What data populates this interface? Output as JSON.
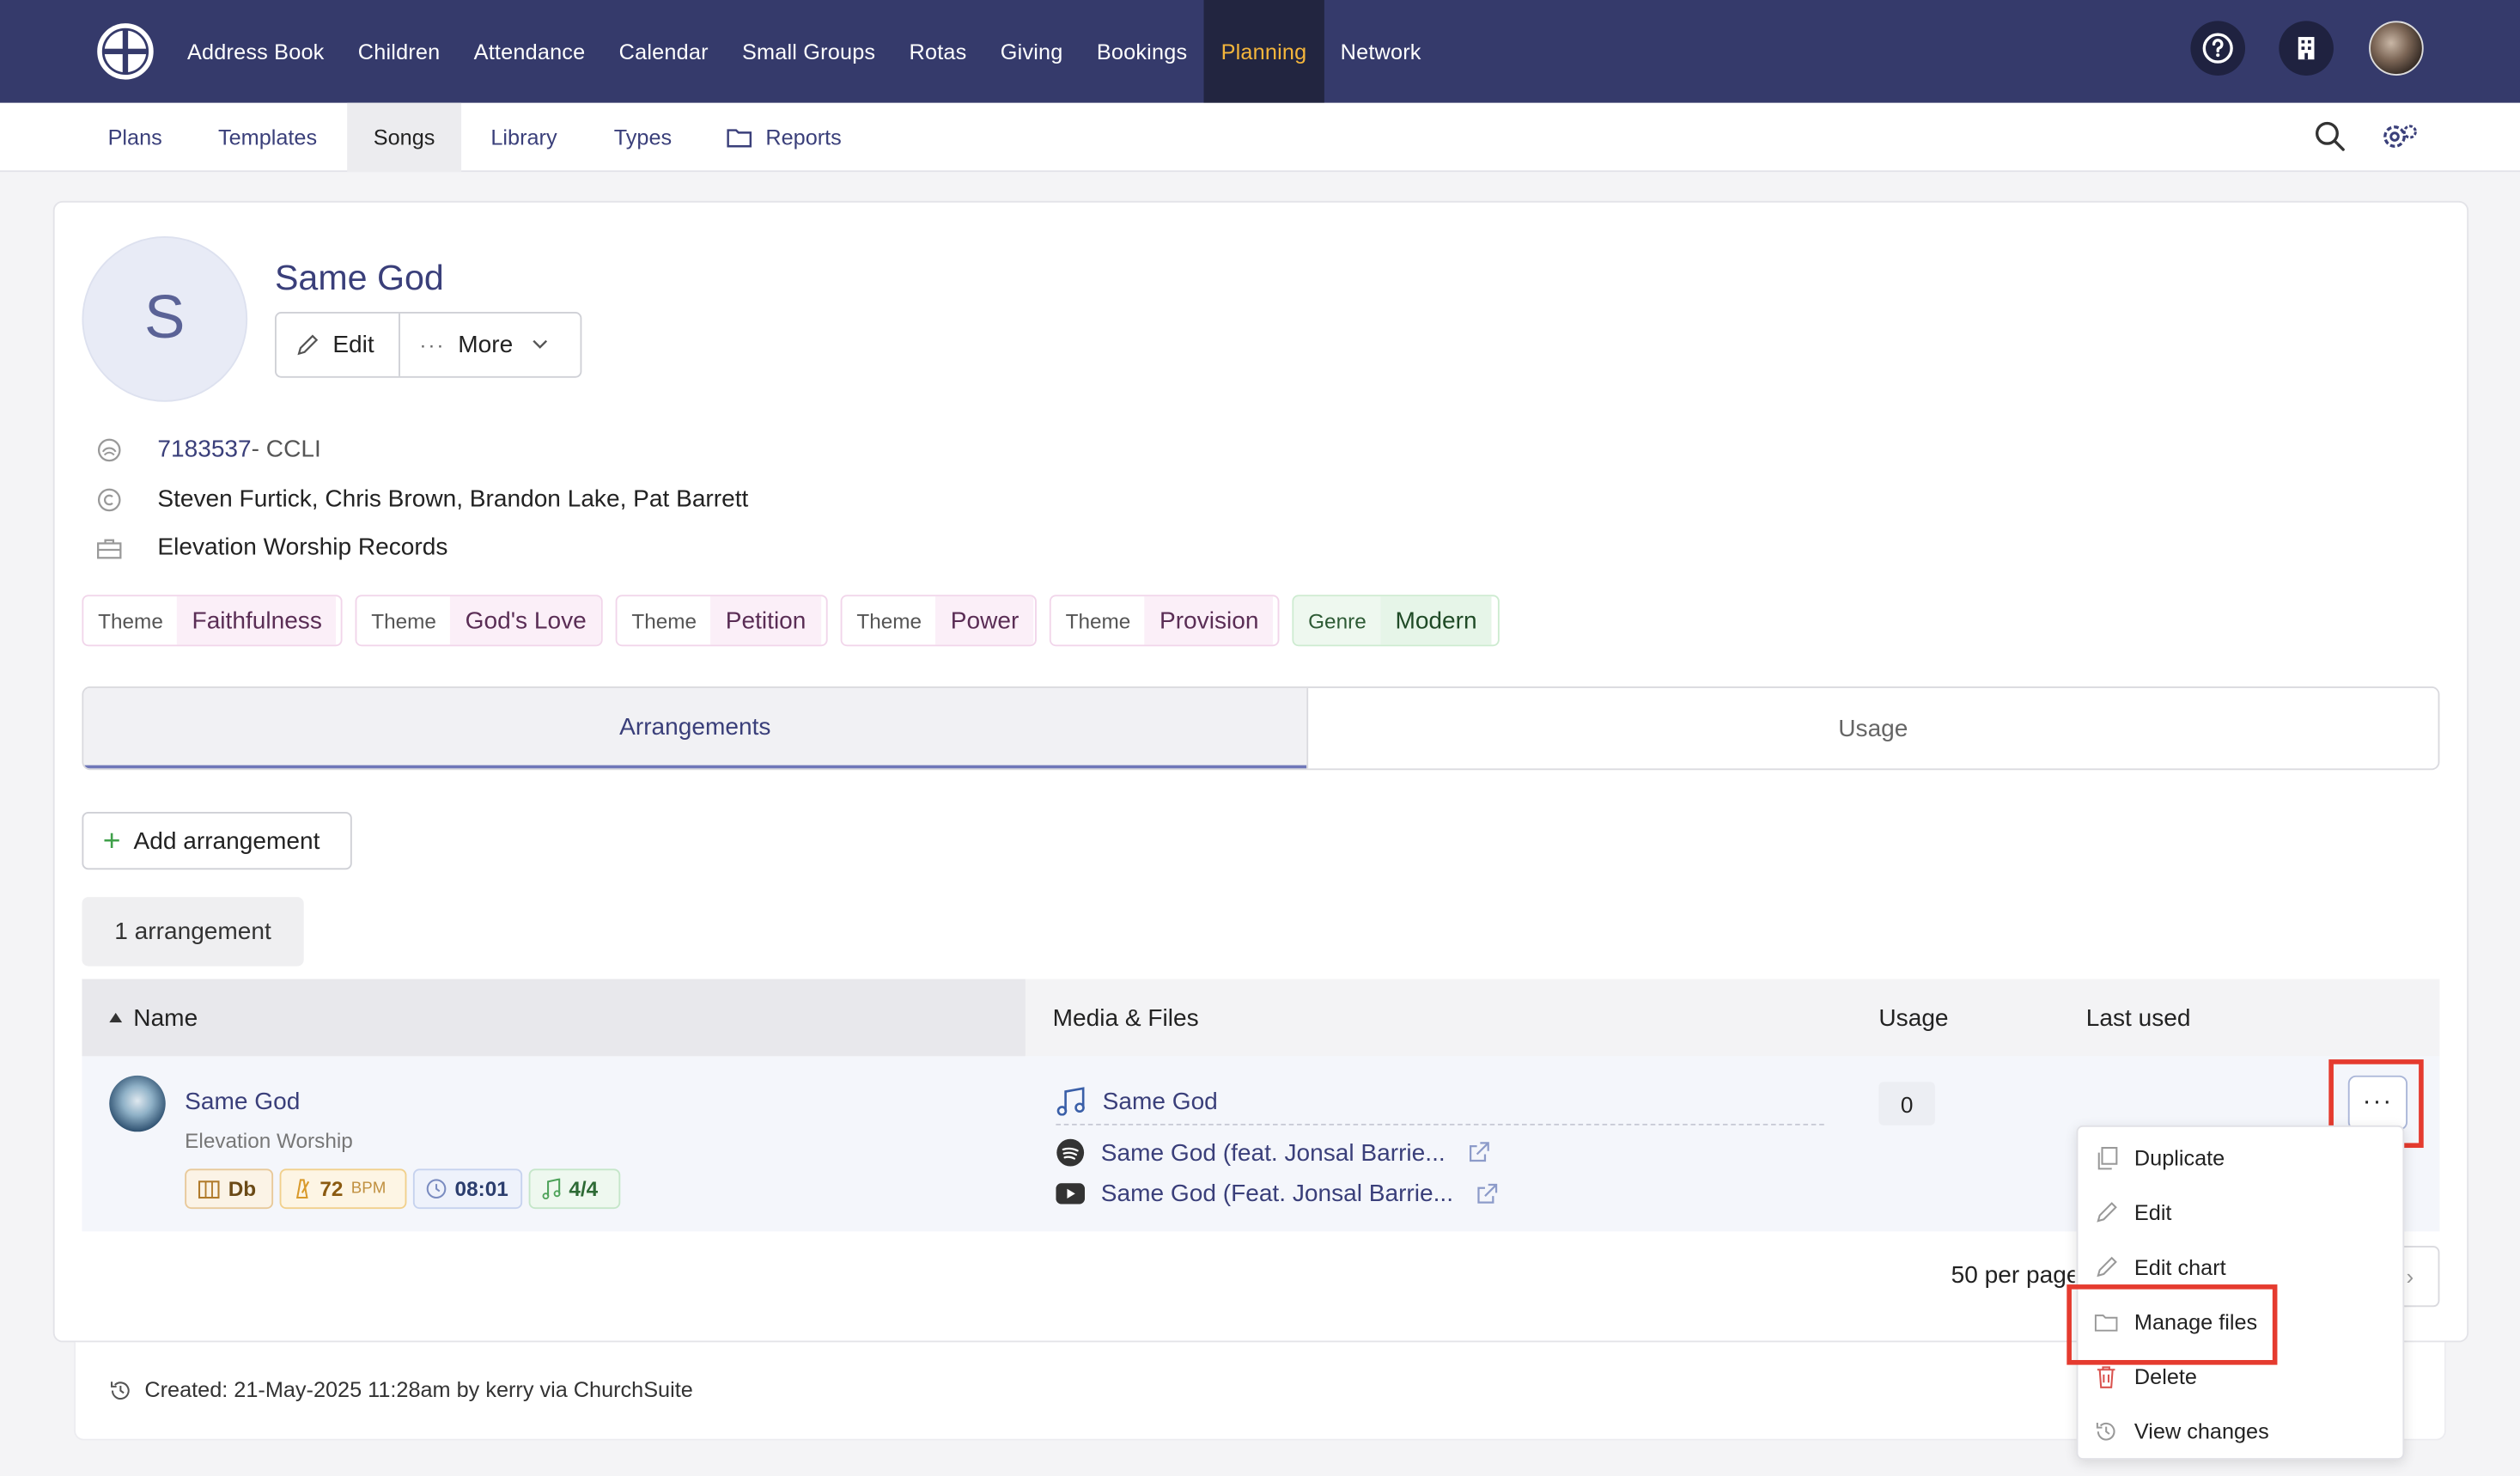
{
  "top_nav": {
    "items": [
      {
        "label": "Address Book"
      },
      {
        "label": "Children"
      },
      {
        "label": "Attendance"
      },
      {
        "label": "Calendar"
      },
      {
        "label": "Small Groups"
      },
      {
        "label": "Rotas"
      },
      {
        "label": "Giving"
      },
      {
        "label": "Bookings"
      },
      {
        "label": "Planning",
        "active": true
      },
      {
        "label": "Network"
      }
    ],
    "active_color": "#f5b63b",
    "bar_color": "#353a6b"
  },
  "sub_nav": {
    "items": [
      {
        "label": "Plans"
      },
      {
        "label": "Templates"
      },
      {
        "label": "Songs",
        "active": true
      },
      {
        "label": "Library"
      },
      {
        "label": "Types"
      },
      {
        "label": "Reports",
        "icon": "folder-icon"
      }
    ]
  },
  "song": {
    "avatar_letter": "S",
    "title": "Same God",
    "edit_label": "Edit",
    "more_label": "More",
    "ccli_number": "7183537",
    "ccli_suffix": " - CCLI",
    "authors": "Steven Furtick, Chris Brown, Brandon Lake, Pat Barrett",
    "publisher": "Elevation Worship Records",
    "tags": [
      {
        "key": "Theme",
        "value": "Faithfulness"
      },
      {
        "key": "Theme",
        "value": "God's Love"
      },
      {
        "key": "Theme",
        "value": "Petition"
      },
      {
        "key": "Theme",
        "value": "Power"
      },
      {
        "key": "Theme",
        "value": "Provision"
      },
      {
        "key": "Genre",
        "value": "Modern"
      }
    ]
  },
  "tabs": [
    {
      "label": "Arrangements",
      "active": true
    },
    {
      "label": "Usage"
    }
  ],
  "add_arrangement_label": "Add arrangement",
  "arrangement_count": "1 arrangement",
  "table": {
    "headers": {
      "name": "Name",
      "media": "Media & Files",
      "usage": "Usage",
      "last_used": "Last used"
    },
    "rows": [
      {
        "name": "Same God",
        "artist": "Elevation Worship",
        "key": "Db",
        "bpm": "72",
        "bpm_unit": "BPM",
        "duration": "08:01",
        "time_sig": "4/4",
        "media": [
          {
            "icon": "music-note-icon",
            "label": "Same God"
          },
          {
            "icon": "spotify-icon",
            "label": "Same God (feat. Jonsal Barrie..."
          },
          {
            "icon": "youtube-icon",
            "label": "Same God (Feat. Jonsal Barrie..."
          }
        ],
        "usage": "0",
        "last_used": ""
      }
    ]
  },
  "row_menu": {
    "items": [
      {
        "label": "Duplicate",
        "icon": "copy-icon"
      },
      {
        "label": "Edit",
        "icon": "pencil-icon"
      },
      {
        "label": "Edit chart",
        "icon": "pencil-icon"
      },
      {
        "label": "Manage files",
        "icon": "folder-icon"
      },
      {
        "label": "Delete",
        "icon": "trash-icon"
      },
      {
        "label": "View changes",
        "icon": "history-icon"
      }
    ]
  },
  "pagination": {
    "per_page": "50 per page"
  },
  "footer": {
    "created": "Created: 21-May-2025 11:28am by kerry via ChurchSuite"
  },
  "highlight_color": "#e53b2f"
}
